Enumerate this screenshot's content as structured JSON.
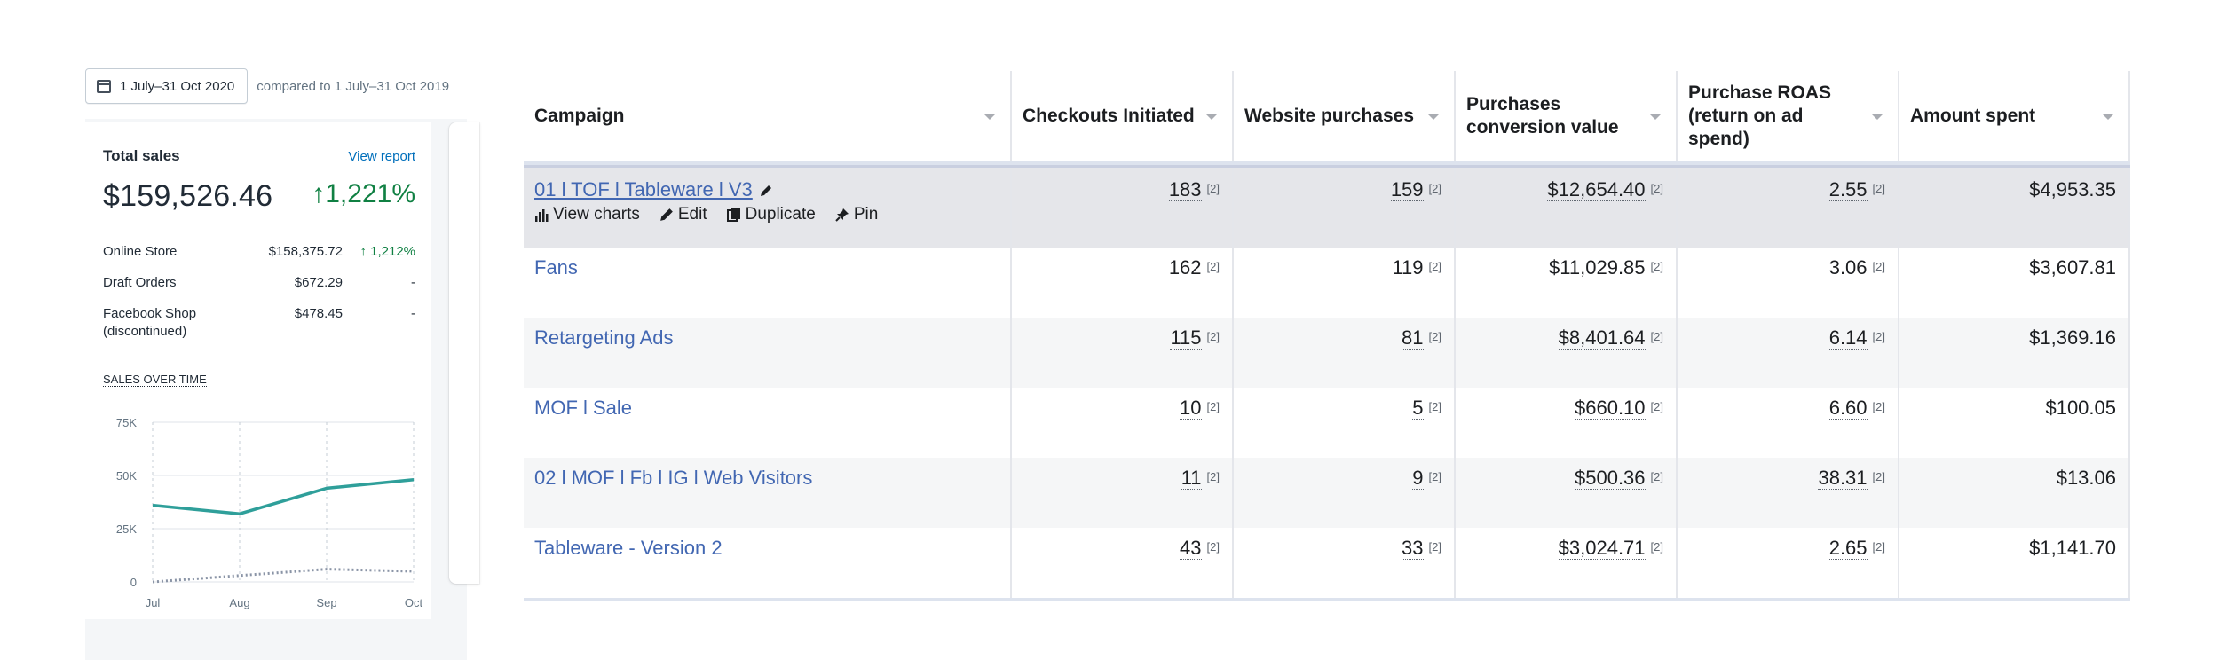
{
  "shopify": {
    "date_range": "1 July–31 Oct 2020",
    "compared_to": "compared to 1 July–31 Oct 2019",
    "total_sales": {
      "title": "Total sales",
      "view_report": "View report",
      "value": "$159,526.46",
      "growth": "1,221%",
      "breakdown": [
        {
          "label": "Online Store",
          "value": "$158,375.72",
          "change": "↑ 1,212%"
        },
        {
          "label": "Draft Orders",
          "value": "$672.29",
          "change": "-"
        },
        {
          "label": "Facebook Shop (discontinued)",
          "value": "$478.45",
          "change": "-"
        }
      ]
    },
    "sales_over_time_label": "SALES OVER TIME",
    "colors": {
      "accent_green": "#108043",
      "link_blue": "#006fbb",
      "line_teal": "#2f9f9a"
    }
  },
  "chart_data": {
    "type": "line",
    "title": "SALES OVER TIME",
    "categories": [
      "Jul",
      "Aug",
      "Sep",
      "Oct"
    ],
    "y_ticks": [
      "75K",
      "50K",
      "25K",
      "0"
    ],
    "ylim": [
      0,
      75000
    ],
    "grid": true,
    "series": [
      {
        "values": [
          36000,
          32000,
          44000,
          48000
        ],
        "style": "solid",
        "color": "#2f9f9a"
      },
      {
        "values": [
          0,
          3000,
          6000,
          5000
        ],
        "style": "dotted",
        "color": "#8a94a6"
      }
    ]
  },
  "fb_table": {
    "columns": [
      "Campaign",
      "Checkouts Initiated",
      "Website purchases",
      "Purchases conversion value",
      "Purchase ROAS (return on ad spend)",
      "Amount spent"
    ],
    "footnote": "[2]",
    "row_actions": [
      "View charts",
      "Edit",
      "Duplicate",
      "Pin"
    ],
    "rows": [
      {
        "campaign": "01 l TOF l Tableware l V3",
        "checkouts": "183",
        "purchases": "159",
        "conv_value": "$12,654.40",
        "roas": "2.55",
        "spent": "$4,953.35"
      },
      {
        "campaign": "Fans",
        "checkouts": "162",
        "purchases": "119",
        "conv_value": "$11,029.85",
        "roas": "3.06",
        "spent": "$3,607.81"
      },
      {
        "campaign": "Retargeting Ads",
        "checkouts": "115",
        "purchases": "81",
        "conv_value": "$8,401.64",
        "roas": "6.14",
        "spent": "$1,369.16"
      },
      {
        "campaign": "MOF l Sale",
        "checkouts": "10",
        "purchases": "5",
        "conv_value": "$660.10",
        "roas": "6.60",
        "spent": "$100.05"
      },
      {
        "campaign": "02 l MOF l Fb l IG l Web Visitors",
        "checkouts": "11",
        "purchases": "9",
        "conv_value": "$500.36",
        "roas": "38.31",
        "spent": "$13.06"
      },
      {
        "campaign": "Tableware - Version 2",
        "checkouts": "43",
        "purchases": "33",
        "conv_value": "$3,024.71",
        "roas": "2.65",
        "spent": "$1,141.70"
      }
    ]
  }
}
